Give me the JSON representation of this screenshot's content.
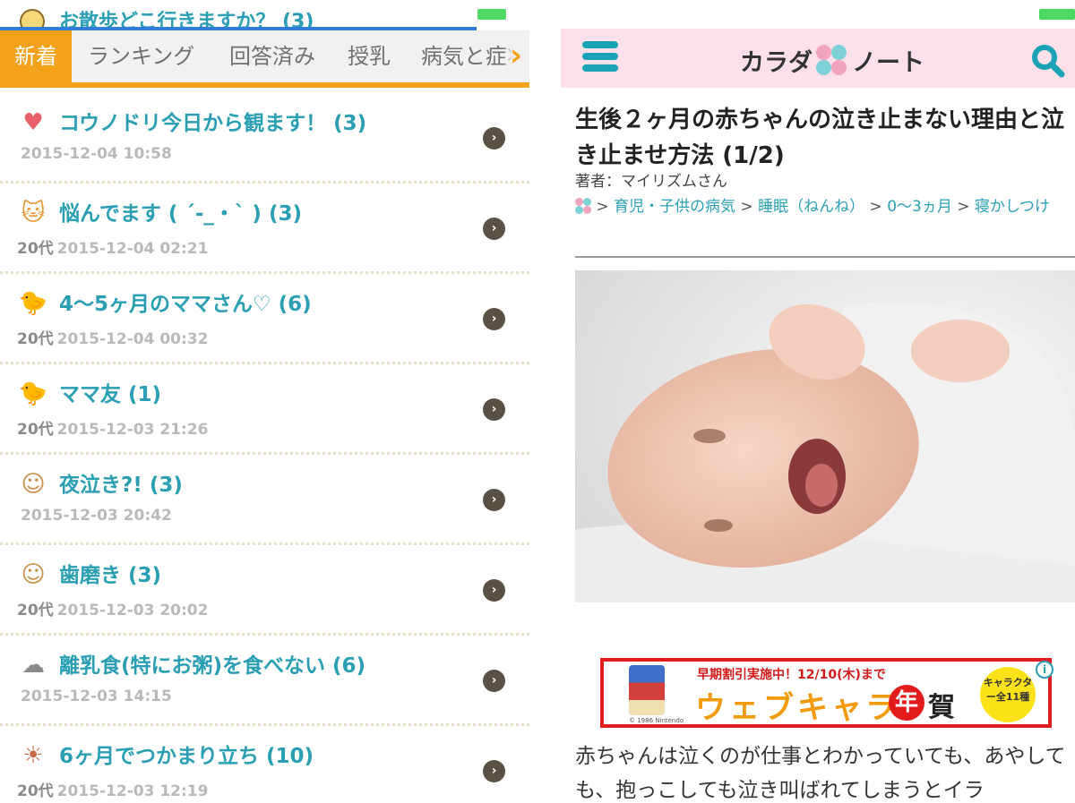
{
  "left": {
    "partial_title": "お散歩どこ行きますか？ (3)",
    "tabs": [
      "新着",
      "ランキング",
      "回答済み",
      "授乳",
      "病気と症状"
    ],
    "threads": [
      {
        "icon": "heart-icon",
        "glyph": "♥",
        "color": "#e8606a",
        "title": "コウノドリ今日から観ます！ (3)",
        "age": "",
        "date": "2015-12-04 10:58"
      },
      {
        "icon": "cat-icon",
        "glyph": "🐱",
        "color": "#e89a3a",
        "title": "悩んでます ( ´-_・` ) (3)",
        "age": "20代",
        "date": "2015-12-04 02:21"
      },
      {
        "icon": "chick-icon",
        "glyph": "🐤",
        "color": "#e7c23a",
        "title": "4〜5ヶ月のママさん♡ (6)",
        "age": "20代",
        "date": "2015-12-04 00:32"
      },
      {
        "icon": "chick-icon",
        "glyph": "🐤",
        "color": "#e7c23a",
        "title": "ママ友 (1)",
        "age": "20代",
        "date": "2015-12-03 21:26"
      },
      {
        "icon": "baby-face-icon",
        "glyph": "☺",
        "color": "#c9904a",
        "title": "夜泣き?! (3)",
        "age": "",
        "date": "2015-12-03 20:42"
      },
      {
        "icon": "baby-face-icon",
        "glyph": "☺",
        "color": "#c9904a",
        "title": "歯磨き (3)",
        "age": "20代",
        "date": "2015-12-03 20:02"
      },
      {
        "icon": "cloud-icon",
        "glyph": "☁",
        "color": "#8a8a8a",
        "title": "離乳食(特にお粥)を食べない (6)",
        "age": "",
        "date": "2015-12-03 14:15"
      },
      {
        "icon": "sun-icon",
        "glyph": "☀",
        "color": "#c96a4a",
        "title": "6ヶ月でつかまり立ち (10)",
        "age": "20代",
        "date": "2015-12-03 12:19"
      }
    ]
  },
  "right": {
    "logo_left": "カラダ",
    "logo_right": "ノート",
    "article_title": "生後２ヶ月の赤ちゃんの泣き止まない理由と泣き止ませ方法 (1/2)",
    "author": "著者：マイリズムさん",
    "breadcrumbs": [
      "育児・子供の病気",
      "睡眠（ねんね）",
      "0〜3ヵ月",
      "寝かしつけ"
    ],
    "ad": {
      "top": "早期割引実施中！12/10(木)まで",
      "main": "ウェブキャラ",
      "nen": "年",
      "ga": "賀",
      "badge": "キャラクター全11種",
      "copyright": "© 1986 Nintendo",
      "info": "i"
    },
    "body_text": "赤ちゃんは泣くのが仕事とわかっていても、あやしても、抱っこしても泣き叫ばれてしまうとイラ"
  },
  "colors": {
    "accent_orange": "#f5a21b",
    "teal": "#2a9fb3",
    "header_pink": "#fde0ea",
    "ad_red": "#e21c1c"
  }
}
